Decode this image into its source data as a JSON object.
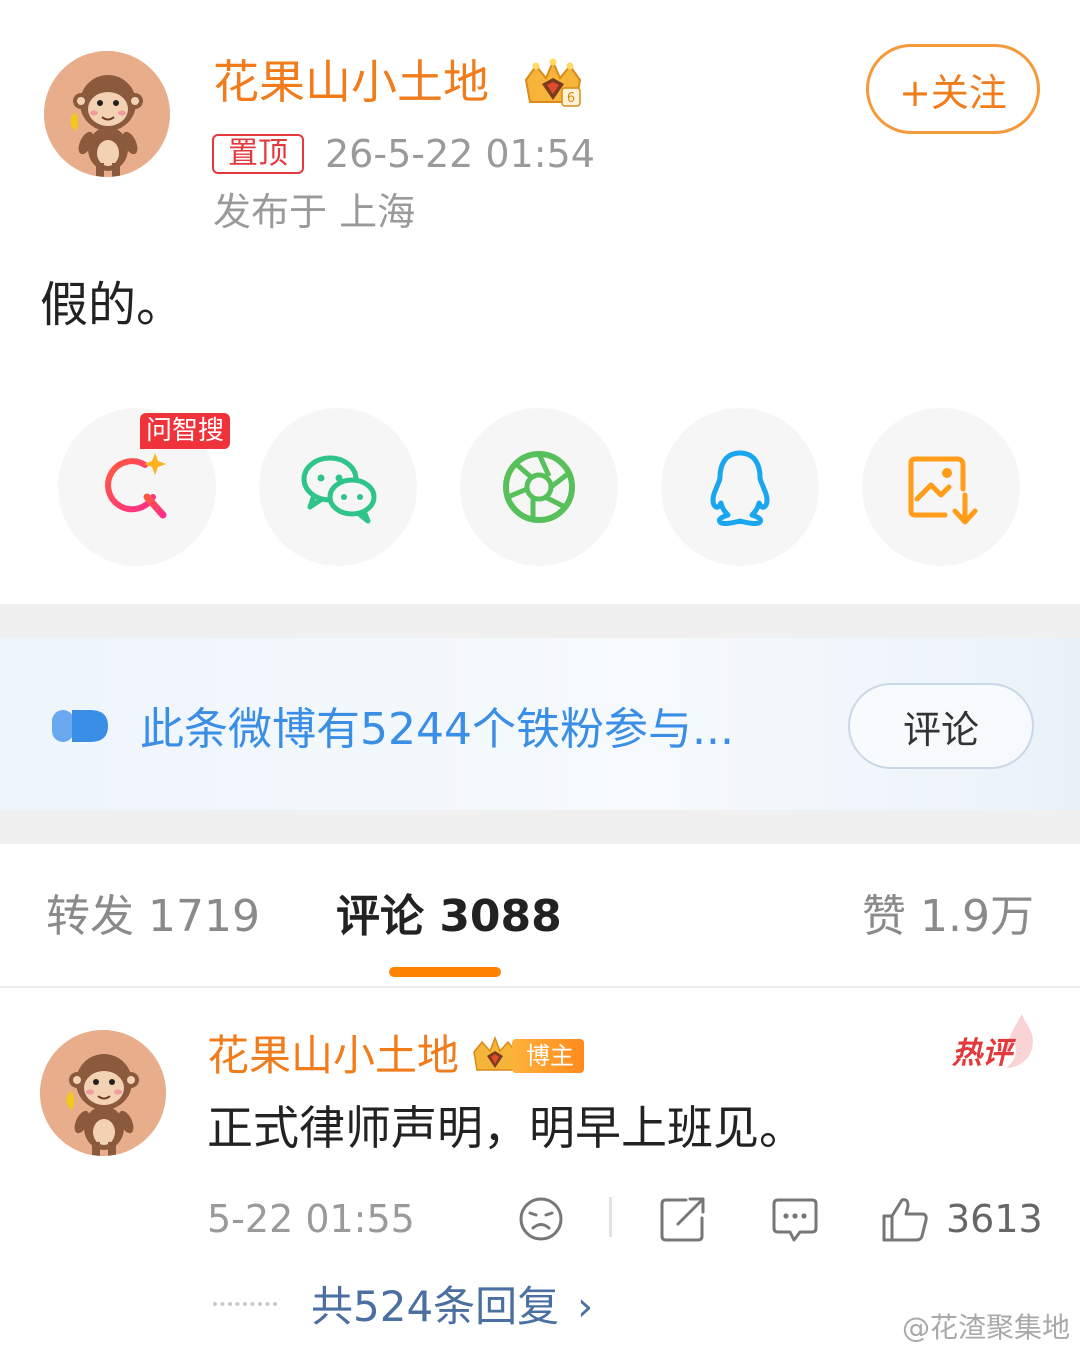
{
  "post": {
    "author_name": "花果山小土地",
    "follow_label": "+关注",
    "pinned_label": "置顶",
    "timestamp": "26-5-22 01:54",
    "location": "发布于 上海",
    "text": "假的。",
    "icons": {
      "avatar": "monkey-avatar",
      "badge": "crown-vip-icon"
    }
  },
  "share": {
    "ask_tag": "问智搜",
    "items": [
      {
        "name": "ai-search",
        "icon": "ai-search-icon"
      },
      {
        "name": "wechat",
        "icon": "wechat-icon"
      },
      {
        "name": "moments",
        "icon": "moments-shutter-icon"
      },
      {
        "name": "qq",
        "icon": "qq-penguin-icon"
      },
      {
        "name": "save-image",
        "icon": "save-image-icon"
      }
    ]
  },
  "fan_banner": {
    "text": "此条微博有5244个铁粉参与...",
    "button_label": "评论"
  },
  "tabs": {
    "repost": "转发 1719",
    "comment": "评论 3088",
    "like": "赞 1.9万",
    "active": "comment",
    "accent": "#ff8200"
  },
  "comment": {
    "author_name": "花果山小土地",
    "blogger_label": "博主",
    "hot_label": "热评",
    "text": "正式律师声明，明早上班见。",
    "timestamp": "5-22 01:55",
    "like_count": "3613",
    "replies_label": "共524条回复",
    "actions": [
      "dislike-face-icon",
      "share-out-icon",
      "comment-bubble-icon",
      "thumbs-up-icon"
    ]
  },
  "watermark": "@花渣聚集地",
  "colors": {
    "brand_orange": "#f07c1b",
    "link_blue": "#3a8ee6",
    "pin_red": "#e4393c"
  }
}
